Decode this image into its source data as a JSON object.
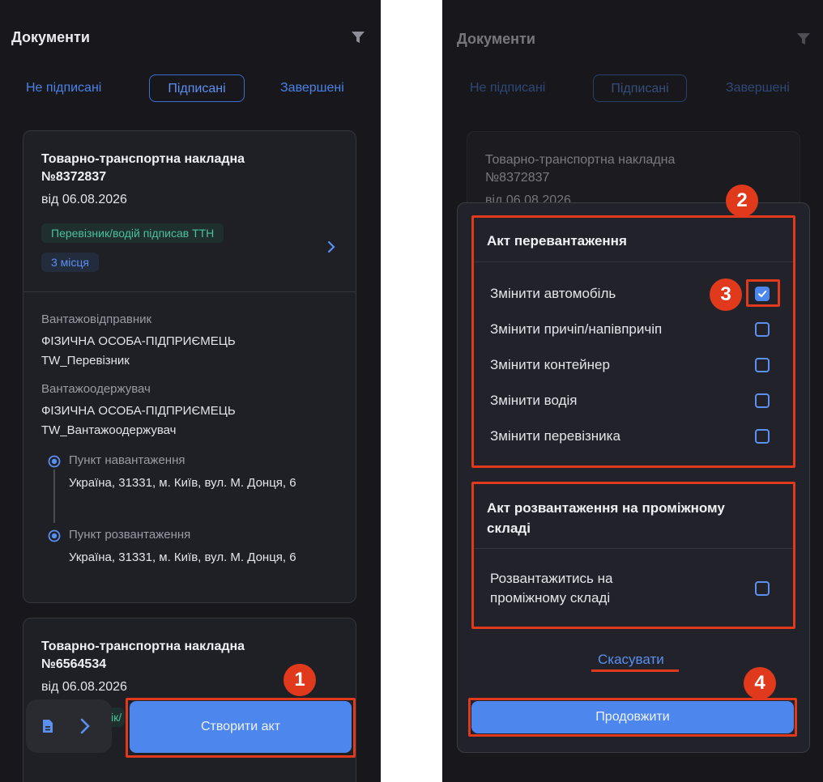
{
  "header": {
    "title": "Документи"
  },
  "tabs": [
    "Не підписані",
    "Підписані",
    "Завершені"
  ],
  "cards": [
    {
      "title": "Товарно-транспортна накладна №8372837",
      "date": "від 06.08.2026",
      "status_badge": "Перевізник/водій підписав ТТН",
      "places_badge": "3 місця",
      "sender_label": "Вантажовідправник",
      "sender_value": "ФІЗИЧНА ОСОБА-ПІДПРИЄМЕЦЬ TW_Перевізник",
      "receiver_label": "Вантажоодержувач",
      "receiver_value": "ФІЗИЧНА ОСОБА-ПІДПРИЄМЕЦЬ TW_Вантажоодержувач",
      "loading_label": "Пункт навантаження",
      "loading_address": "Україна, 31331, м. Київ, вул. М. Донця, 6",
      "unloading_label": "Пункт розвантаження",
      "unloading_address": "Україна, 31331, м. Київ, вул. М. Донця, 6"
    },
    {
      "title": "Товарно-транспортна накладна №6564534",
      "date": "від 06.08.2026",
      "status_badge_fragment": "ік/"
    }
  ],
  "create_act_button": "Створити акт",
  "modal": {
    "section1_title": "Акт перевантаження",
    "options": [
      {
        "label": "Змінити автомобіль",
        "checked": true
      },
      {
        "label": "Змінити причіп/напівпричіп",
        "checked": false
      },
      {
        "label": "Змінити контейнер",
        "checked": false
      },
      {
        "label": "Змінити водія",
        "checked": false
      },
      {
        "label": "Змінити перевізника",
        "checked": false
      }
    ],
    "section2_title": "Акт розвантаження на проміжному складі",
    "section2_option": {
      "label": "Розвантажитись на проміжному складі",
      "checked": false
    },
    "cancel_label": "Скасувати",
    "continue_label": "Продовжити"
  },
  "steps": [
    "1",
    "2",
    "3",
    "4"
  ],
  "colors": {
    "accent": "#4d86ec",
    "highlight": "#e0391c",
    "background": "#18181c"
  },
  "icons": [
    "filter-icon",
    "chevron-right-icon",
    "radio-dot-icon",
    "document-icon",
    "checkbox-icon"
  ]
}
